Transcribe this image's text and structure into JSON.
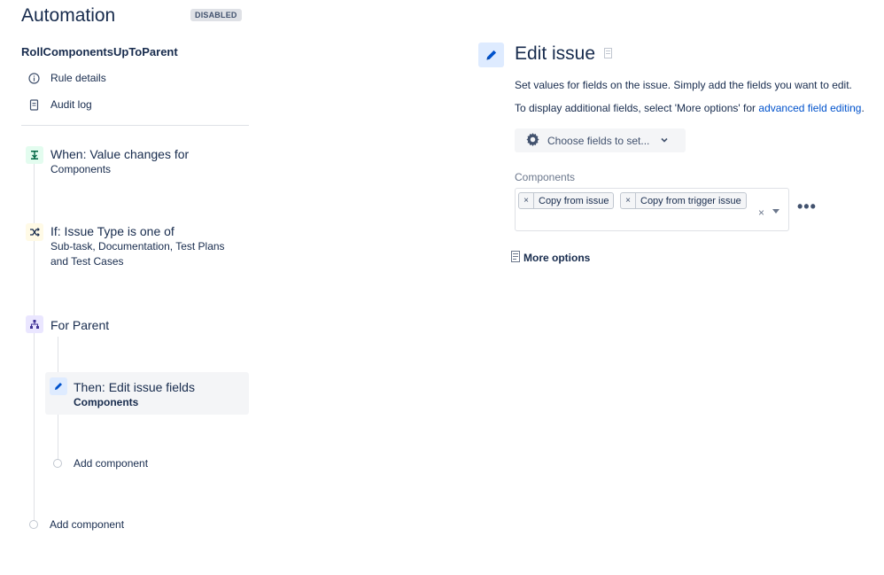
{
  "header": {
    "title": "Automation",
    "status_badge": "DISABLED"
  },
  "rule": {
    "name": "RollComponentsUpToParent"
  },
  "nav": {
    "rule_details": "Rule details",
    "audit_log": "Audit log"
  },
  "flow": {
    "trigger": {
      "title": "When: Value changes for",
      "subtitle": "Components",
      "icon": "trigger-icon",
      "color": "#e3fcef"
    },
    "condition": {
      "title": "If: Issue Type is one of",
      "subtitle_line1": "Sub-task, Documentation, Test Plans",
      "subtitle_line2": "and Test Cases",
      "icon": "shuffle-icon",
      "color": "#fffae6"
    },
    "branch": {
      "title": "For Parent",
      "icon": "hierarchy-icon",
      "color": "#eae6ff"
    },
    "action": {
      "title": "Then: Edit issue fields",
      "subtitle": "Components",
      "icon": "pencil-icon",
      "color": "#deebff"
    },
    "add_component_inner": "Add component",
    "add_component_outer": "Add component"
  },
  "editor": {
    "title": "Edit issue",
    "desc1": "Set values for fields on the issue. Simply add the fields you want to edit.",
    "desc2_prefix": "To display additional fields, select 'More options' for ",
    "desc2_link": "advanced field editing",
    "desc2_suffix": ".",
    "choose_fields": "Choose fields to set...",
    "components_label": "Components",
    "tags": [
      "Copy from issue",
      "Copy from trigger issue"
    ],
    "more_options": "More options"
  }
}
